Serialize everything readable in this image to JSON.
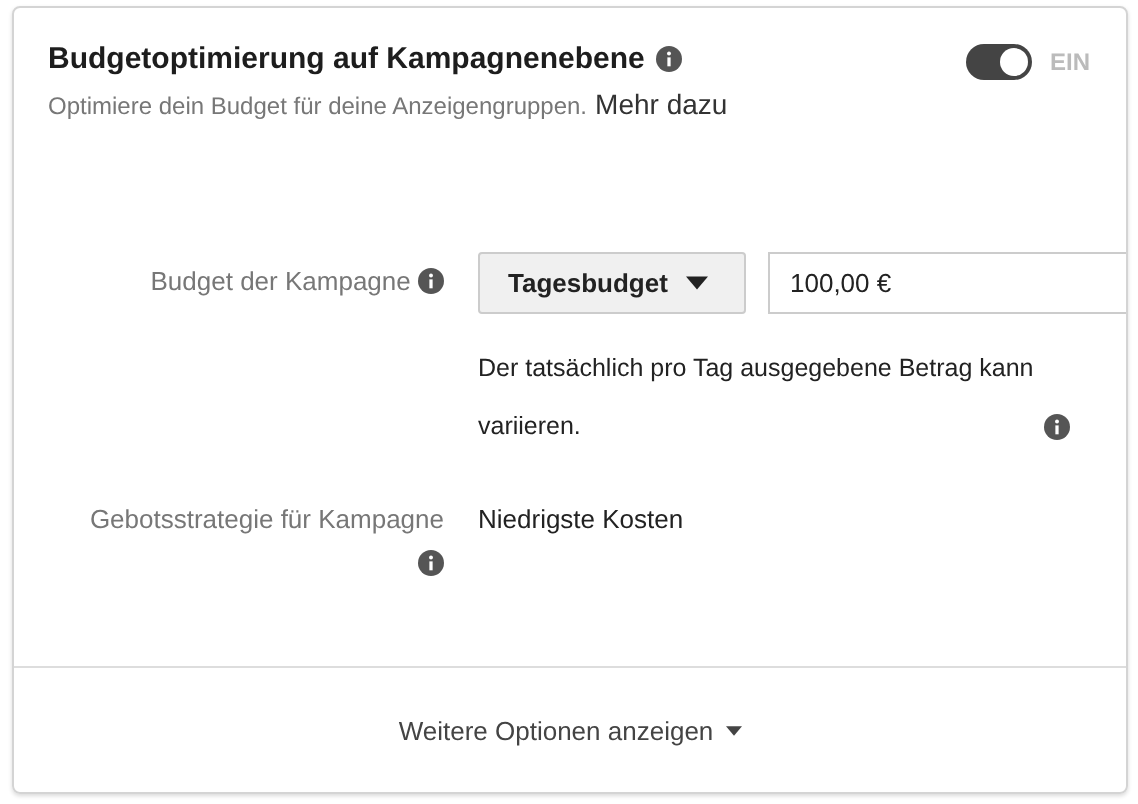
{
  "header": {
    "title": "Budgetoptimierung auf Kampagnenebene",
    "subtitle": "Optimiere dein Budget für deine Anzeigengruppen.",
    "learn_more": "Mehr dazu",
    "toggle": {
      "on": true,
      "label": "EIN"
    }
  },
  "budget": {
    "label": "Budget der Kampagne",
    "type_dropdown": "Tagesbudget",
    "amount": "100,00 €",
    "note": "Der tatsächlich pro Tag ausgegebene Betrag kann variieren."
  },
  "bid_strategy": {
    "label": "Gebotsstrategie für Kampagne",
    "value": "Niedrigste Kosten"
  },
  "footer": {
    "more_options": "Weitere Optionen anzeigen"
  }
}
